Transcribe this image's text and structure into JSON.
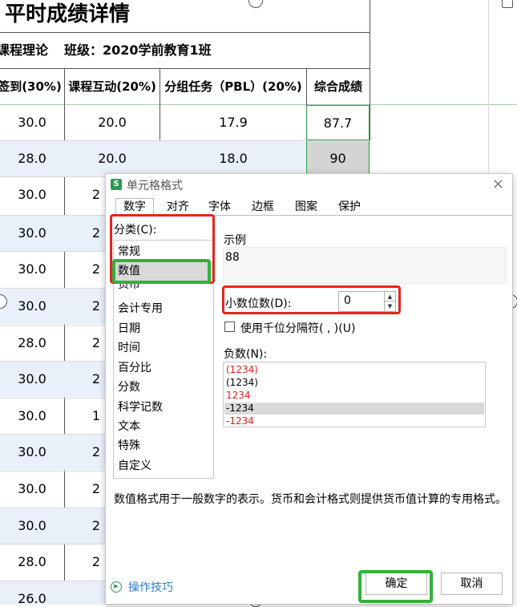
{
  "sheet": {
    "title": "平时成绩详情",
    "subtitle_course": "课程理论",
    "subtitle_class": "班级：2020学前教育1班",
    "headers": [
      "签到(30%)",
      "课程互动(20%)",
      "分组任务（PBL）(20%)",
      "综合成绩"
    ],
    "rows": [
      {
        "c1": "30.0",
        "c2": "20.0",
        "c3": "17.9",
        "c4": "87.7"
      },
      {
        "c1": "28.0",
        "c2": "20.0",
        "c3": "18.0",
        "c4": "90"
      },
      {
        "c1": "30.0",
        "c2": "2"
      },
      {
        "c1": "30.0",
        "c2": "2"
      },
      {
        "c1": "30.0",
        "c2": "2"
      },
      {
        "c1": "30.0",
        "c2": "2"
      },
      {
        "c1": "28.0",
        "c2": "2"
      },
      {
        "c1": "30.0",
        "c2": "2"
      },
      {
        "c1": "30.0",
        "c2": "1"
      },
      {
        "c1": "30.0",
        "c2": "2"
      },
      {
        "c1": "30.0",
        "c2": "2"
      },
      {
        "c1": "30.0",
        "c2": "2"
      },
      {
        "c1": "28.0",
        "c2": "2"
      },
      {
        "c1": "26.0",
        "c2": ""
      }
    ]
  },
  "dialog": {
    "app_icon": "S",
    "title": "单元格格式",
    "close": "×",
    "tabs": [
      "数字",
      "对齐",
      "字体",
      "边框",
      "图案",
      "保护"
    ],
    "category_label": "分类(C):",
    "categories": [
      "常规",
      "数值",
      "货币",
      "会计专用",
      "日期",
      "时间",
      "百分比",
      "分数",
      "科学记数",
      "文本",
      "特殊",
      "自定义"
    ],
    "selected_category": "数值",
    "sample_label": "示例",
    "sample_value": "88",
    "decimal_label": "小数位数(D):",
    "decimal_value": "0",
    "thousands_label": "使用千位分隔符( , )(U)",
    "negative_label": "负数(N):",
    "negative_options": [
      {
        "text": "(1234)",
        "color": "#e0201b"
      },
      {
        "text": "(1234)",
        "color": "#000000"
      },
      {
        "text": "1234",
        "color": "#e0201b"
      },
      {
        "text": "-1234",
        "color": "#000000"
      },
      {
        "text": "-1234",
        "color": "#e0201b"
      }
    ],
    "selected_negative_index": 3,
    "description": "数值格式用于一般数字的表示。货币和会计格式则提供货币值计算的专用格式。",
    "tips": "操作技巧",
    "ok": "确定",
    "cancel": "取消"
  },
  "colors": {
    "annotation_red": "#e8241a",
    "annotation_green": "#33b13a",
    "selection_green": "#2e9e48",
    "alt_row": "#e9f0fa",
    "link_blue": "#2f7ccf"
  }
}
